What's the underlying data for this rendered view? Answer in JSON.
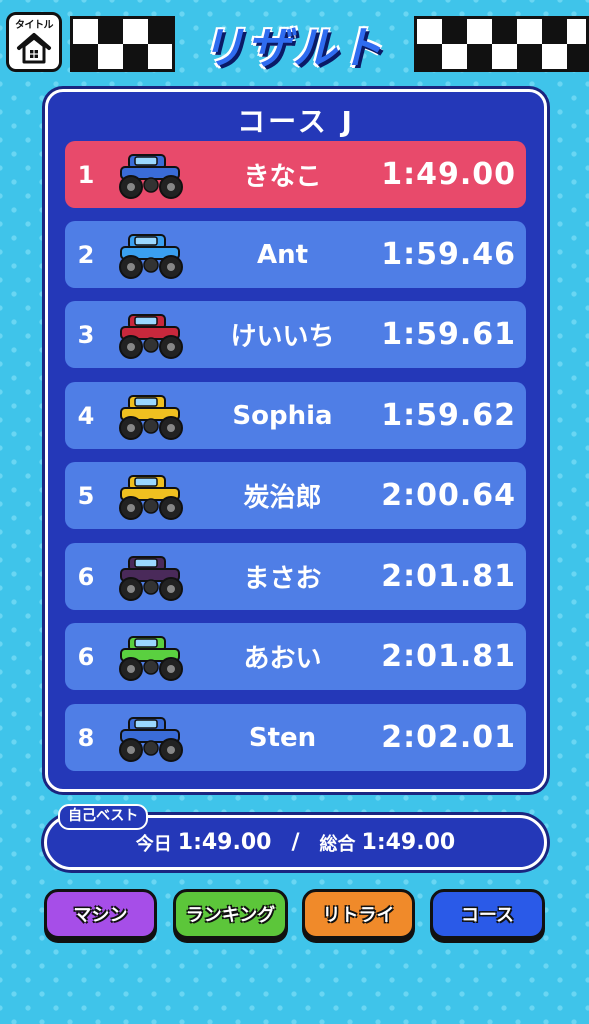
{
  "header": {
    "home_label": "タイトル",
    "title": "リザルト"
  },
  "course": {
    "name": "コース J"
  },
  "results": [
    {
      "rank": "1",
      "name": "きなこ",
      "time": "1:49.00",
      "car_color": "#3a6cd8",
      "highlight": true
    },
    {
      "rank": "2",
      "name": "Ant",
      "time": "1:59.46",
      "car_color": "#3aa0f0",
      "highlight": false
    },
    {
      "rank": "3",
      "name": "けいいち",
      "time": "1:59.61",
      "car_color": "#c8283c",
      "highlight": false
    },
    {
      "rank": "4",
      "name": "Sophia",
      "time": "1:59.62",
      "car_color": "#f0c020",
      "highlight": false
    },
    {
      "rank": "5",
      "name": "炭治郎",
      "time": "2:00.64",
      "car_color": "#f0c020",
      "highlight": false
    },
    {
      "rank": "6",
      "name": "まさお",
      "time": "2:01.81",
      "car_color": "#4a2a5a",
      "highlight": false
    },
    {
      "rank": "6",
      "name": "あおい",
      "time": "2:01.81",
      "car_color": "#5ad040",
      "highlight": false
    },
    {
      "rank": "8",
      "name": "Sten",
      "time": "2:02.01",
      "car_color": "#3a6cd8",
      "highlight": false
    }
  ],
  "personal_best": {
    "label": "自己ベスト",
    "today_label": "今日",
    "today_time": "1:49.00",
    "separator": "/",
    "overall_label": "総合",
    "overall_time": "1:49.00"
  },
  "buttons": [
    {
      "label": "マシン",
      "color": "#a64ee8"
    },
    {
      "label": "ランキング",
      "color": "#5cc63a"
    },
    {
      "label": "リトライ",
      "color": "#f08a2a"
    },
    {
      "label": "コース",
      "color": "#2a5ae8"
    }
  ]
}
